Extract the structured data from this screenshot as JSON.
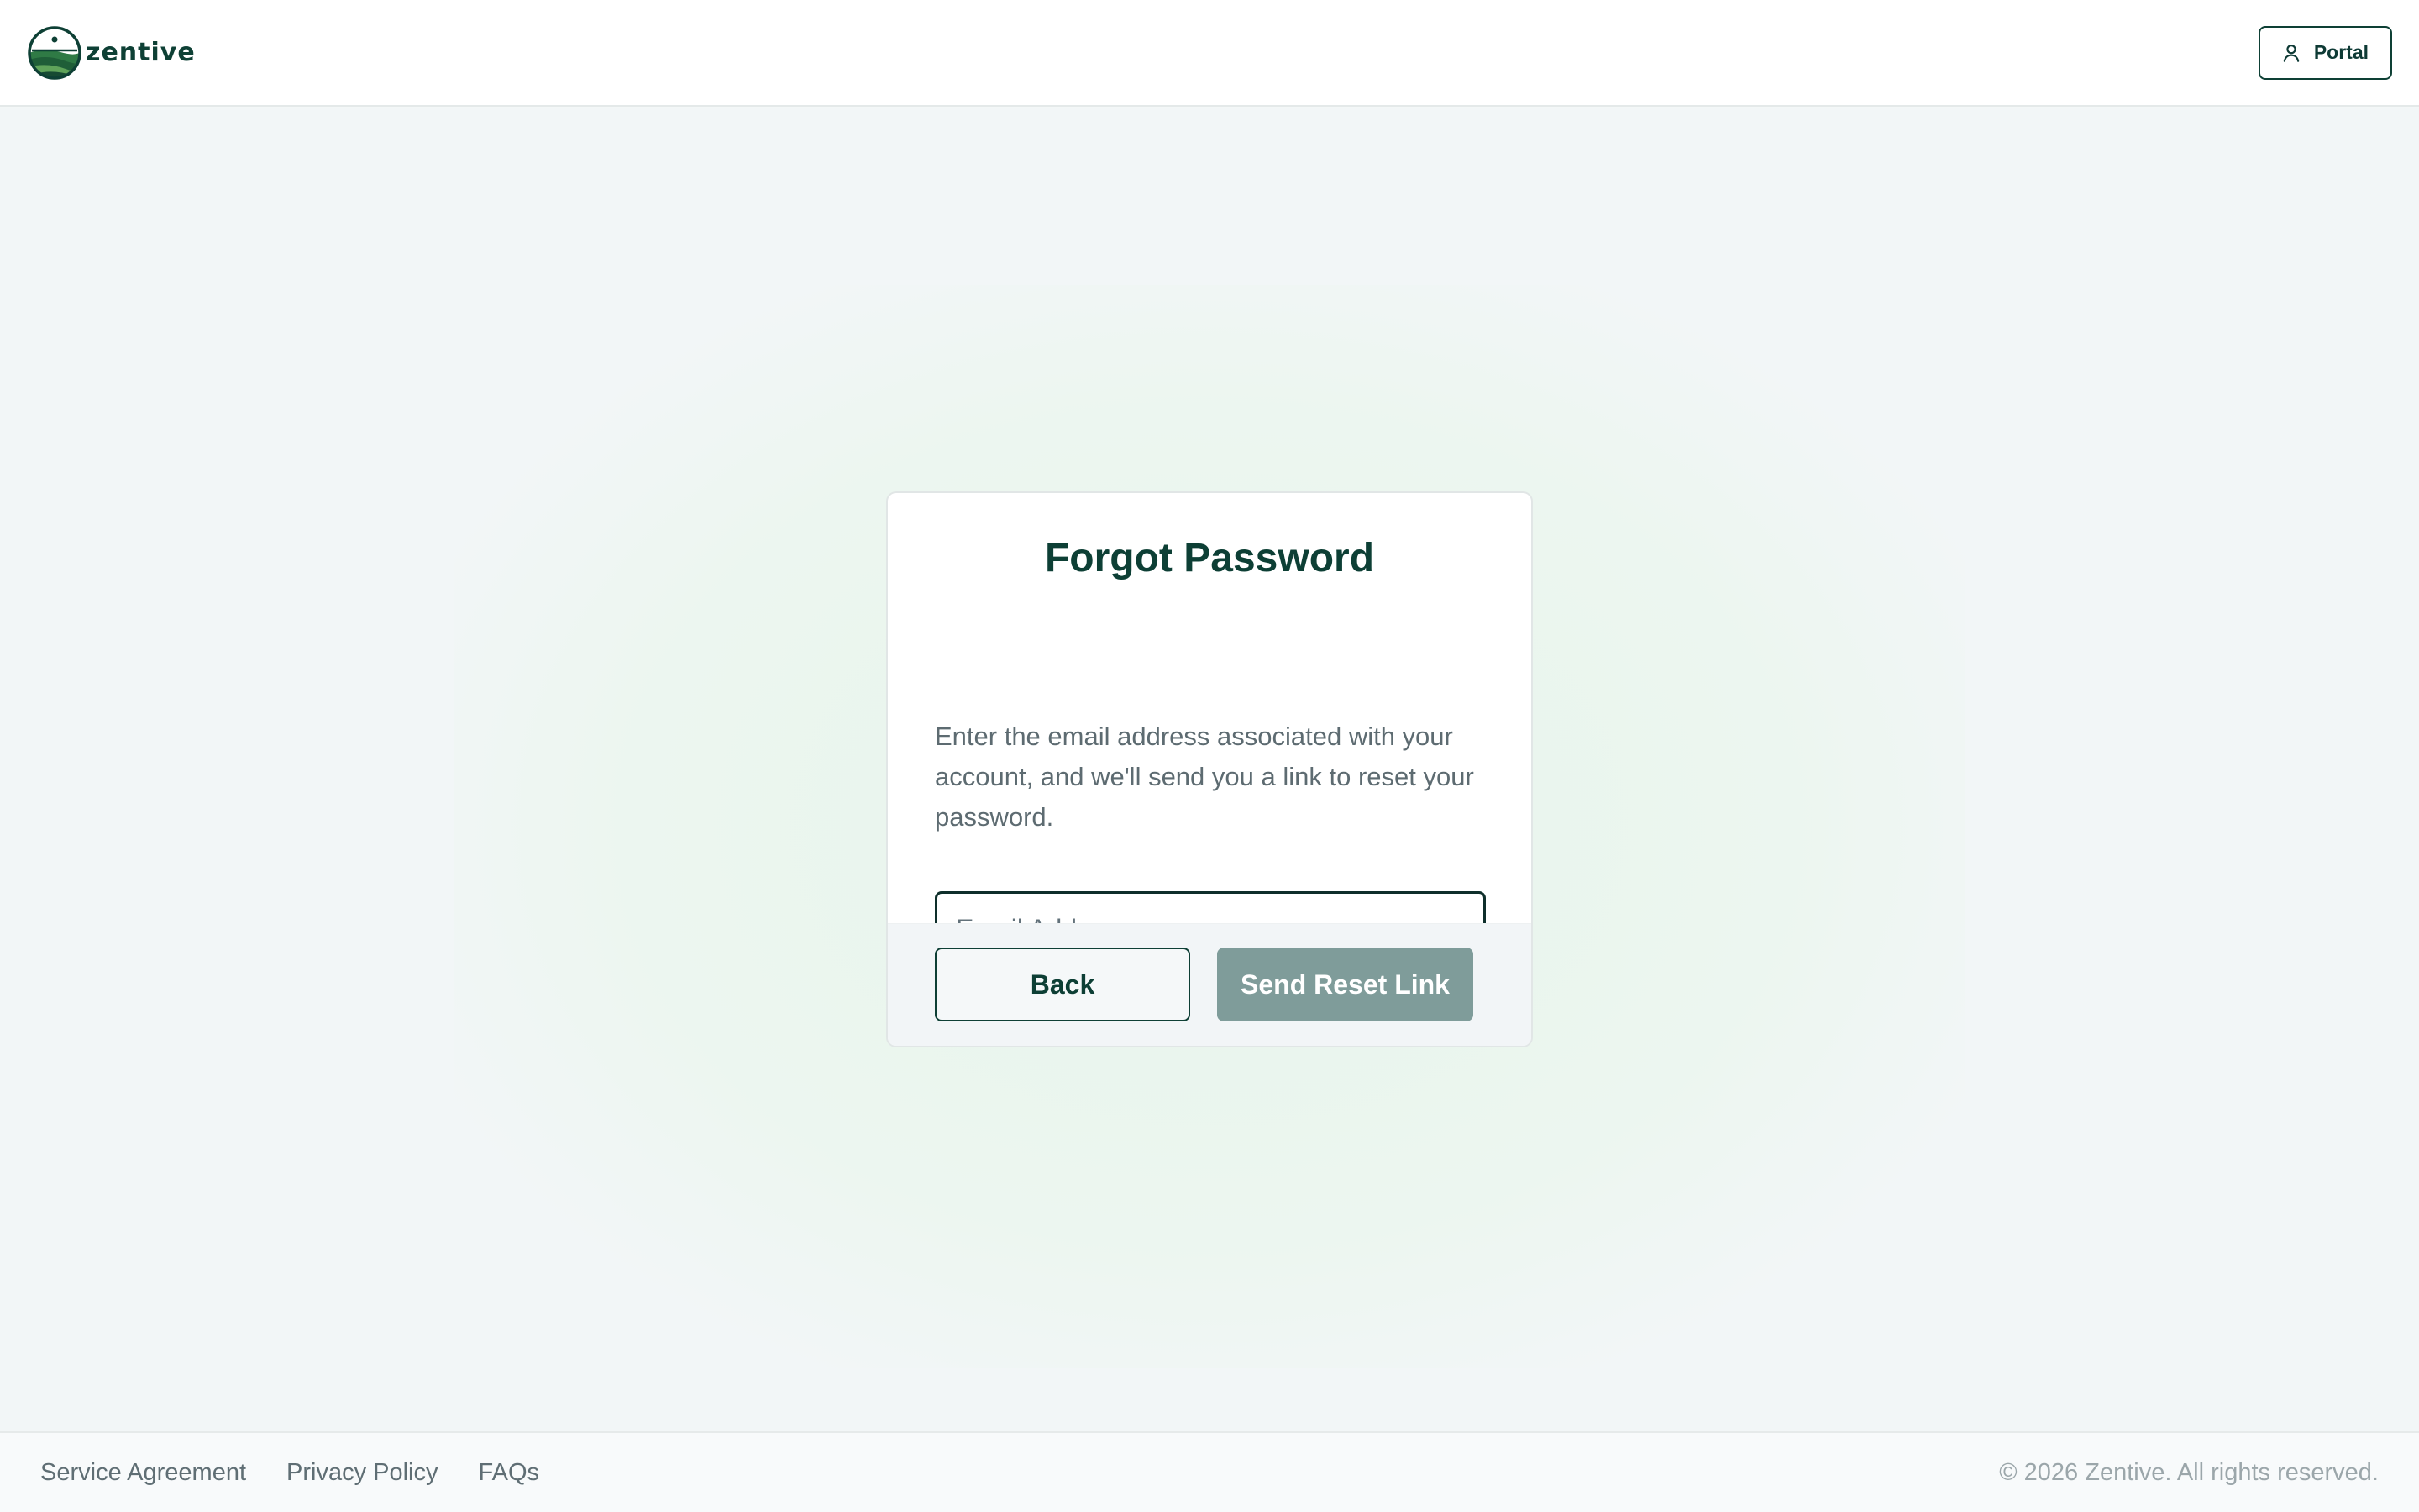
{
  "header": {
    "brand_name": "zentive",
    "portal_label": "Portal"
  },
  "card": {
    "title": "Forgot Password",
    "description": "Enter the email address associated with your account, and we'll send you a link to reset your password.",
    "email_placeholder": "Email Address",
    "email_value": "",
    "back_label": "Back",
    "send_label": "Send Reset Link"
  },
  "footer": {
    "links": [
      "Service Agreement",
      "Privacy Policy",
      "FAQs"
    ],
    "copyright": "© 2026 Zentive. All rights reserved."
  },
  "icons": {
    "brand": "zentive-logo-icon",
    "portal": "user-icon"
  },
  "colors": {
    "brand_green": "#0e4035",
    "send_button_disabled": "#7f9c9a",
    "page_background": "#f2f6f7"
  }
}
